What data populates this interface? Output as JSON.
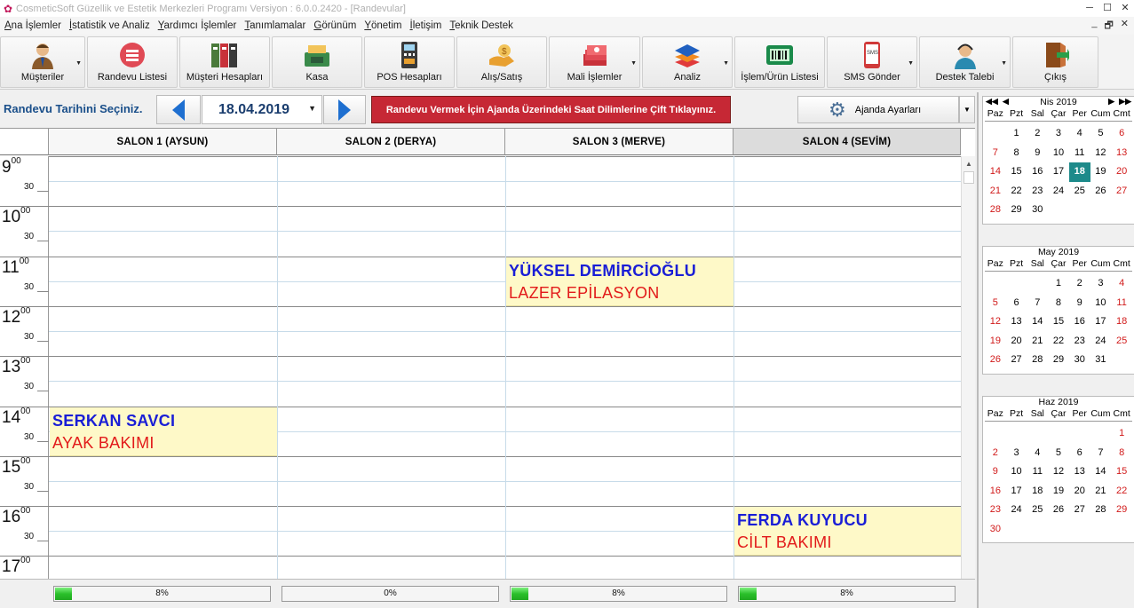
{
  "window": {
    "title": "CosmeticSoft Güzellik ve Estetik Merkezleri Programı Versiyon : 6.0.0.2420 - [Randevular]"
  },
  "menu": [
    "Ana İşlemler",
    "İstatistik ve Analiz",
    "Yardımcı İşlemler",
    "Tanımlamalar",
    "Görünüm",
    "Yönetim",
    "İletişim",
    "Teknik Destek"
  ],
  "toolbar": [
    {
      "label": "Müşteriler",
      "icon": "person-icon",
      "dropdown": true
    },
    {
      "label": "Randevu Listesi",
      "icon": "list-icon",
      "dropdown": false
    },
    {
      "label": "Müşteri Hesapları",
      "icon": "binders-icon",
      "dropdown": false
    },
    {
      "label": "Kasa",
      "icon": "cash-register-icon",
      "dropdown": false
    },
    {
      "label": "POS Hesapları",
      "icon": "pos-terminal-icon",
      "dropdown": false
    },
    {
      "label": "Alış/Satış",
      "icon": "exchange-hands-icon",
      "dropdown": false
    },
    {
      "label": "Mali İşlemler",
      "icon": "money-stack-icon",
      "dropdown": true
    },
    {
      "label": "Analiz",
      "icon": "layers-icon",
      "dropdown": true
    },
    {
      "label": "İşlem/Ürün Listesi",
      "icon": "barcode-scanner-icon",
      "dropdown": false
    },
    {
      "label": "SMS Gönder",
      "icon": "phone-sms-icon",
      "dropdown": true
    },
    {
      "label": "Destek Talebi",
      "icon": "support-agent-icon",
      "dropdown": true
    },
    {
      "label": "Çıkış",
      "icon": "exit-door-icon",
      "dropdown": false
    }
  ],
  "datebar": {
    "label": "Randevu Tarihini Seçiniz.",
    "date": "18.04.2019",
    "notice": "Randevu Vermek İçin Ajanda Üzerindeki Saat Dilimlerine Çift Tıklayınız.",
    "settings_label": "Ajanda Ayarları"
  },
  "salons": [
    "SALON 1 (AYSUN)",
    "SALON 2 (DERYA)",
    "SALON 3 (MERVE)",
    "SALON 4 (SEVİM)"
  ],
  "selected_salon": 3,
  "hours": [
    "9",
    "10",
    "11",
    "12",
    "13",
    "14",
    "15",
    "16",
    "17"
  ],
  "hour_suffix": "00",
  "half_label": "30",
  "appointments": [
    {
      "salon": 2,
      "start": "11:00",
      "end": "12:00",
      "name": "YÜKSEL DEMİRCİOĞLU",
      "service": "LAZER EPİLASYON"
    },
    {
      "salon": 0,
      "start": "14:00",
      "end": "15:00",
      "name": "SERKAN SAVCI",
      "service": "AYAK BAKIMI"
    },
    {
      "salon": 3,
      "start": "16:00",
      "end": "17:00",
      "name": "FERDA KUYUCU",
      "service": "CİLT BAKIMI"
    }
  ],
  "progress": [
    {
      "value": 8,
      "label": "8%"
    },
    {
      "value": 0,
      "label": "0%"
    },
    {
      "value": 8,
      "label": "8%"
    },
    {
      "value": 8,
      "label": "8%"
    }
  ],
  "calendar": {
    "dow": [
      "Paz",
      "Pzt",
      "Sal",
      "Çar",
      "Per",
      "Cum",
      "Cmt"
    ],
    "months": [
      {
        "title": "Nis 2019",
        "nav": true,
        "offset": 1,
        "days": 30,
        "today": 18
      },
      {
        "title": "May 2019",
        "nav": false,
        "offset": 3,
        "days": 31,
        "today": null
      },
      {
        "title": "Haz 2019",
        "nav": false,
        "offset": 6,
        "days": 30,
        "today": null
      }
    ]
  },
  "colors": {
    "notice_bg": "#c62835",
    "appt_bg": "#fef9c8",
    "appt_name": "#1a1ed6",
    "appt_service": "#e21a1a",
    "today_bg": "#1d8a8a",
    "weekend": "#d11a1a"
  }
}
